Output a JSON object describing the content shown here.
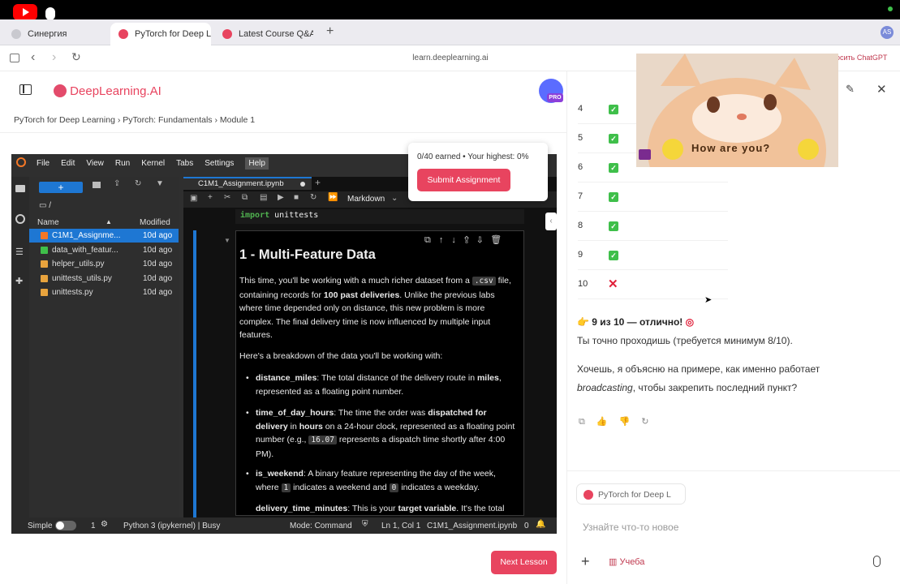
{
  "browser": {
    "tabs": [
      {
        "label": "Синергия"
      },
      {
        "label": "PyTorch for Deep Le"
      },
      {
        "label": "Latest Course Q&A/F"
      }
    ],
    "new_tab": "+",
    "url": "learn.deeplearning.ai",
    "profile_initials": "AS",
    "chatgpt_hint": "осить ChatGPT"
  },
  "course": {
    "brand": "DeepLearning.AI",
    "pro_badge": "PRO",
    "breadcrumb": [
      "PyTorch for Deep Learning",
      "PyTorch: Fundamentals",
      "Module 1"
    ],
    "score_text": "0/40 earned • Your highest: 0%",
    "submit_label": "Submit Assignment",
    "next_label": "Next Lesson"
  },
  "jupyter": {
    "menu": [
      "File",
      "Edit",
      "View",
      "Run",
      "Kernel",
      "Tabs",
      "Settings",
      "Help"
    ],
    "path": "/",
    "columns": {
      "name": "Name",
      "modified": "Modified"
    },
    "files": [
      {
        "name": "C1M1_Assignme...",
        "modified": "10d ago"
      },
      {
        "name": "data_with_featur...",
        "modified": "10d ago"
      },
      {
        "name": "helper_utils.py",
        "modified": "10d ago"
      },
      {
        "name": "unittests_utils.py",
        "modified": "10d ago"
      },
      {
        "name": "unittests.py",
        "modified": "10d ago"
      }
    ],
    "notebook_tab": "C1M1_Assignment.ipynb",
    "cell_type": "Markdown",
    "code_line_kw": "import",
    "code_line_rest": " unittests",
    "heading": "1 - Multi-Feature Data",
    "p1_a": "This time, you'll be working with a much richer dataset from a ",
    "p1_code": ".csv",
    "p1_b": " file, containing records for ",
    "p1_bold": "100 past deliveries",
    "p1_c": ". Unlike the previous labs where time depended only on distance, this new problem is more complex. The final delivery time is now influenced by multiple input features.",
    "p2": "Here's a breakdown of the data you'll be working with:",
    "b1_key": "distance_miles",
    "b1_a": ": The total distance of the delivery route in ",
    "b1_bold": "miles",
    "b1_b": ", represented as a floating point number.",
    "b2_key": "time_of_day_hours",
    "b2_a": ": The time the order was ",
    "b2_bold": "dispatched for delivery",
    "b2_b": " in ",
    "b2_bold2": "hours",
    "b2_c": " on a 24-hour clock, represented as a floating point number (e.g., ",
    "b2_code": "16.07",
    "b2_d": " represents a dispatch time shortly after 4:00 PM).",
    "b3_key": "is_weekend",
    "b3_a": ": A binary feature representing the day of the week, where ",
    "b3_code1": "1",
    "b3_b": " indicates a weekend and ",
    "b3_code2": "0",
    "b3_c": " indicates a weekday.",
    "b4_key": "delivery_time_minutes",
    "b4_a": ": This is your ",
    "b4_bold": "target variable",
    "b4_b": ". It's the total",
    "status": {
      "mode_label": "Simple",
      "count": "1",
      "kernel": "Python 3 (ipykernel) | Busy",
      "command": "Mode: Command",
      "position": "Ln 1, Col 1",
      "file": "C1M1_Assignment.ipynb",
      "zero": "0"
    }
  },
  "chat": {
    "rows": [
      {
        "n": "4",
        "ok": true
      },
      {
        "n": "5",
        "ok": true
      },
      {
        "n": "6",
        "ok": true
      },
      {
        "n": "7",
        "ok": true
      },
      {
        "n": "8",
        "ok": true
      },
      {
        "n": "9",
        "ok": true
      },
      {
        "n": "10",
        "ok": false
      }
    ],
    "verdict": "9 из 10 — отлично!",
    "line1": "Ты точно проходишь (требуется минимум 8/10).",
    "line2": "Хочешь, я объясню на примере, как именно работает",
    "line3_italic": "broadcasting",
    "line3_rest": ", чтобы закрепить последний пункт?",
    "context_chip": "PyTorch for Deep L",
    "input_placeholder": "Узнайте что-то новое",
    "study_label": "Учеба",
    "overlay_text": "How are you?"
  },
  "colors": {
    "accent": "#e8445f",
    "link": "#1a73e8"
  }
}
